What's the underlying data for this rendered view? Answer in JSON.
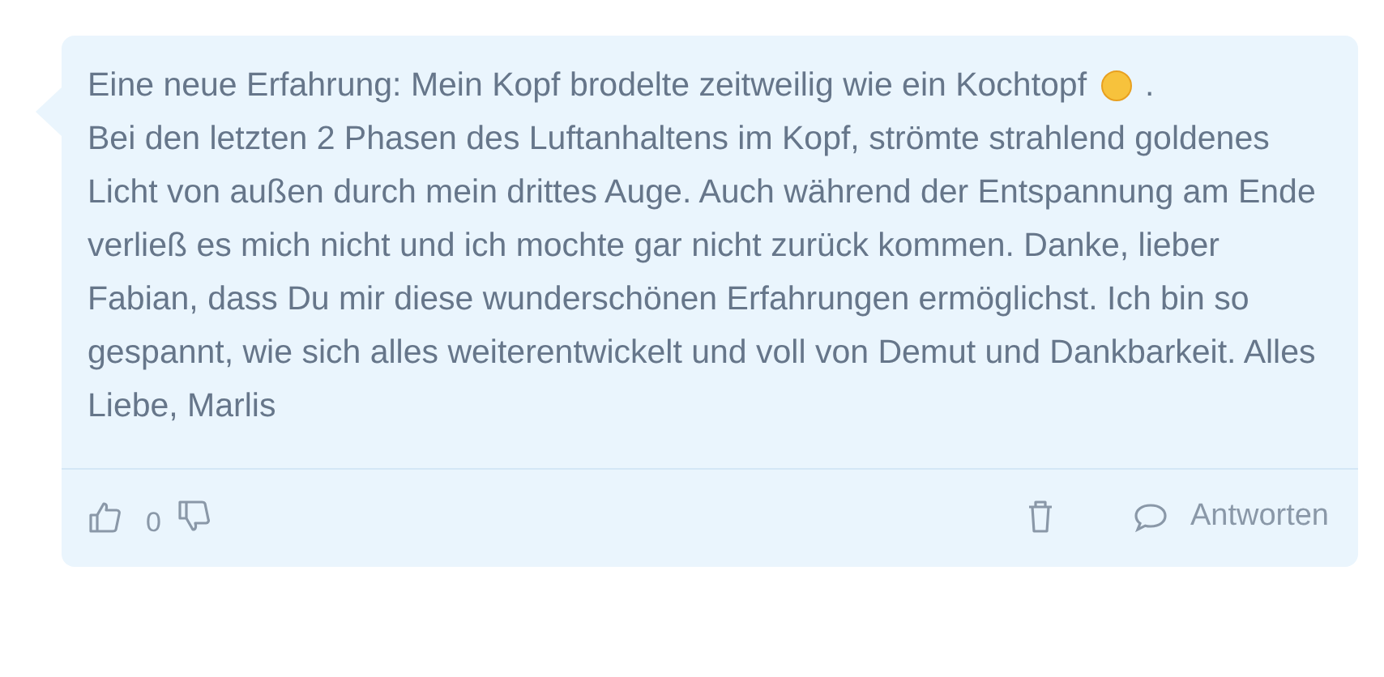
{
  "comment": {
    "text_before": "Eine neue Erfahrung: Mein Kopf brodelte zeitweilig wie ein Kochtopf",
    "text_mid": ".",
    "text_after": "Bei den letzten 2 Phasen des Luftanhaltens im Kopf, strömte strahlend goldenes Licht von außen durch mein drittes Auge. Auch während der Entspannung am Ende verließ es mich nicht und ich mochte gar nicht zurück kommen. Danke, lieber Fabian, dass Du mir diese wunderschönen Erfahrungen ermöglichst. Ich bin so gespannt, wie sich alles weiterentwickelt und voll von Demut und Dankbarkeit. Alles Liebe, Marlis"
  },
  "votes": {
    "count": "0"
  },
  "reply": {
    "label": "Antworten"
  }
}
